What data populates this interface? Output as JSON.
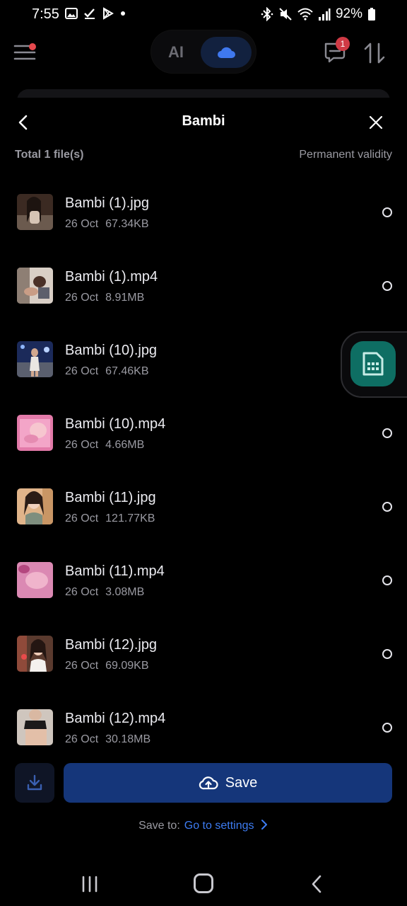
{
  "status_bar": {
    "time": "7:55",
    "battery": "92%",
    "left_icons": [
      "gallery-icon",
      "check-icon",
      "play-store-icon",
      "dot-icon"
    ],
    "right_icons": [
      "bluetooth-icon",
      "mute-icon",
      "wifi-icon",
      "signal-icon",
      "battery-icon"
    ]
  },
  "topbar": {
    "segment_ai_label": "AI",
    "chat_badge_count": "1",
    "accent": "#12213f"
  },
  "sheet": {
    "title": "Bambi",
    "total_label": "Total 1 file(s)",
    "validity_label": "Permanent validity"
  },
  "files": [
    {
      "name": "Bambi (1).jpg",
      "date": "26 Oct",
      "size": "67.34KB"
    },
    {
      "name": "Bambi (1).mp4",
      "date": "26 Oct",
      "size": "8.91MB"
    },
    {
      "name": "Bambi (10).jpg",
      "date": "26 Oct",
      "size": "67.46KB"
    },
    {
      "name": "Bambi (10).mp4",
      "date": "26 Oct",
      "size": "4.66MB"
    },
    {
      "name": "Bambi (11).jpg",
      "date": "26 Oct",
      "size": "121.77KB"
    },
    {
      "name": "Bambi (11).mp4",
      "date": "26 Oct",
      "size": "3.08MB"
    },
    {
      "name": "Bambi (12).jpg",
      "date": "26 Oct",
      "size": "69.09KB"
    },
    {
      "name": "Bambi (12).mp4",
      "date": "26 Oct",
      "size": "30.18MB"
    }
  ],
  "actions": {
    "save_label": "Save",
    "save_to_label": "Save to:",
    "save_to_link": "Go to settings",
    "save_color": "#15367a",
    "link_color": "#3d7cf2"
  }
}
